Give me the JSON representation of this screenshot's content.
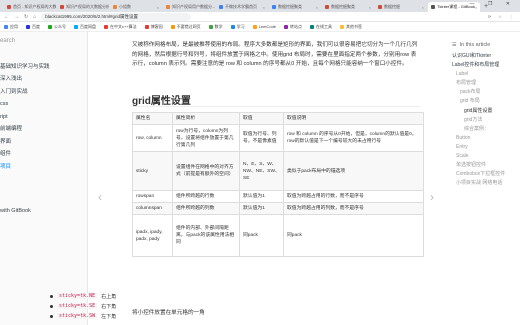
{
  "browser": {
    "tabs": [
      {
        "label": "首页 - 知识产权局的大数据分析...",
        "favicon_color": "#d04a3a",
        "active": false
      },
      {
        "label": "知识产权局的大数据分析",
        "favicon_color": "#d04a3a",
        "active": false
      },
      {
        "label": "小组数",
        "favicon_color": "#e8843c",
        "active": false
      },
      {
        "label": "知识产权局用户数据分...",
        "favicon_color": "#e8843c",
        "active": false
      },
      {
        "label": "不做技术学霸首页",
        "favicon_color": "#3b82f6",
        "active": false
      },
      {
        "label": "数据挖掘聚类",
        "favicon_color": "#3b82f6",
        "active": false
      },
      {
        "label": "数据挖掘聚类",
        "favicon_color": "#d04a3a",
        "active": false
      },
      {
        "label": "数据挖掘",
        "favicon_color": "#d04a3a",
        "active": false
      },
      {
        "label": "Tkinter课程 - GitBook",
        "favicon_color": "#555555",
        "active": true
      }
    ],
    "new_tab": "+",
    "window_controls": "— ❐ ✕",
    "url": "blackcat1995.com/2020/6/2.html#grid属性设置",
    "extensions": "⟳ ☆ ⋮"
  },
  "bookmarks": [
    {
      "label": "应用",
      "color": "#4285f4"
    },
    {
      "label": "百度",
      "color": "#2932e1"
    },
    {
      "label": "公众号",
      "color": "#1aad19"
    },
    {
      "label": "百度网盘",
      "color": "#06a7ff"
    },
    {
      "label": "在中文c++算法",
      "color": "#e53935"
    },
    {
      "label": "博客园",
      "color": "#e53935"
    },
    {
      "label": "不要错过网页",
      "color": "#ff9800"
    },
    {
      "label": "数学",
      "color": "#43a047"
    },
    {
      "label": "学习",
      "color": "#1e88e5"
    },
    {
      "label": "LeetCode",
      "color": "#ffa116"
    },
    {
      "label": "转站点",
      "color": "#8e24aa"
    },
    {
      "label": "在线工具",
      "color": "#00897b"
    },
    {
      "label": "其他书签",
      "color": "#fbc02d"
    }
  ],
  "sidebar": {
    "search_placeholder": "earch",
    "items": [
      {
        "label": "",
        "active": false
      },
      {
        "label": "基础知识学习与实践",
        "active": false
      },
      {
        "label": "深入浅出",
        "active": false
      },
      {
        "label": "入门到实战",
        "active": false
      },
      {
        "label": "css",
        "active": false
      },
      {
        "label": "ript",
        "active": false
      },
      {
        "label": "前端编程",
        "active": false
      },
      {
        "label": "界面",
        "active": false
      },
      {
        "label": "组件",
        "active": false
      },
      {
        "label": "项目",
        "active": true
      }
    ],
    "footer": "with GitBook"
  },
  "content": {
    "intro": "又被称作网格布局，是最被推荐使用的布局。程序大多数都是矩形的界面，我们可以很容易把它切分为一个几行几列的网格，然后根据行号和列号，将组件放置于网格之中。使用grid 布局时，需要在里面指定两个参数，分别用row 表示行，column 表示列。需要注意的是 row 和 column 的序号都从0 开始，且每个网格只能容纳一个窗口小控件。",
    "heading": "grid属性设置",
    "table": {
      "headers": [
        "属性名",
        "属性简析",
        "取值",
        "取值说明"
      ],
      "rows": [
        [
          "row, column",
          "row为行号，column为列号，设置将组件放置于第几行第几列",
          "取值为行号、列号，不是像素值",
          "row 和 column 的序号从0开始，但是，column的默认值是0，row的默认值是下一个编号较大的未占用行号"
        ],
        [
          "sticky",
          "设置组件在网格中的对齐方式（前提是有额外的空间）",
          "N、E、S、W、NW、NE、SW、SE",
          "类似于pack布局中的锚选项"
        ],
        [
          "rowspan",
          "组件所跨越的行数",
          "默认值为1",
          "取值为跨越占用的行数，而不是序号"
        ],
        [
          "columnspan",
          "组件所跨越的列数",
          "默认值为1",
          "取值为跨越占用的列数，而不是序号"
        ],
        [
          "ipadx, ipady, padx, pady",
          "组件的内部、外部间隔距离，与pack的该属性用法相同",
          "同pack",
          "同pack"
        ]
      ]
    },
    "after_text": "将小控件放置在单元格的一角",
    "code_list": [
      {
        "code": "sticky=tk.NE",
        "desc": "右上角"
      },
      {
        "code": "sticky=tk.SE",
        "desc": "右下角"
      },
      {
        "code": "sticky=tk.SW",
        "desc": "左下角"
      }
    ],
    "prev_arrow": "‹",
    "next_arrow": "›"
  },
  "toc": {
    "heading": "In this article",
    "items": [
      {
        "label": "认识GUI和Tkinter",
        "level": 0
      },
      {
        "label": "Label控件和布局管理",
        "level": 0
      },
      {
        "label": "Label",
        "level": 1
      },
      {
        "label": "布局管理",
        "level": 1
      },
      {
        "label": "pack布局",
        "level": 2
      },
      {
        "label": "grid 布局",
        "level": 2
      },
      {
        "label": "grid属性设置",
        "level": 3
      },
      {
        "label": "grid方法",
        "level": 3
      },
      {
        "label": "综合案例：",
        "level": 3
      },
      {
        "label": "Button",
        "level": 1
      },
      {
        "label": "Entry",
        "level": 1
      },
      {
        "label": "Scale",
        "level": 1
      },
      {
        "label": "单选按钮控件",
        "level": 1
      },
      {
        "label": "Combobox下拉框控件",
        "level": 1
      },
      {
        "label": "小项目实战 网络电话",
        "level": 1
      }
    ]
  }
}
